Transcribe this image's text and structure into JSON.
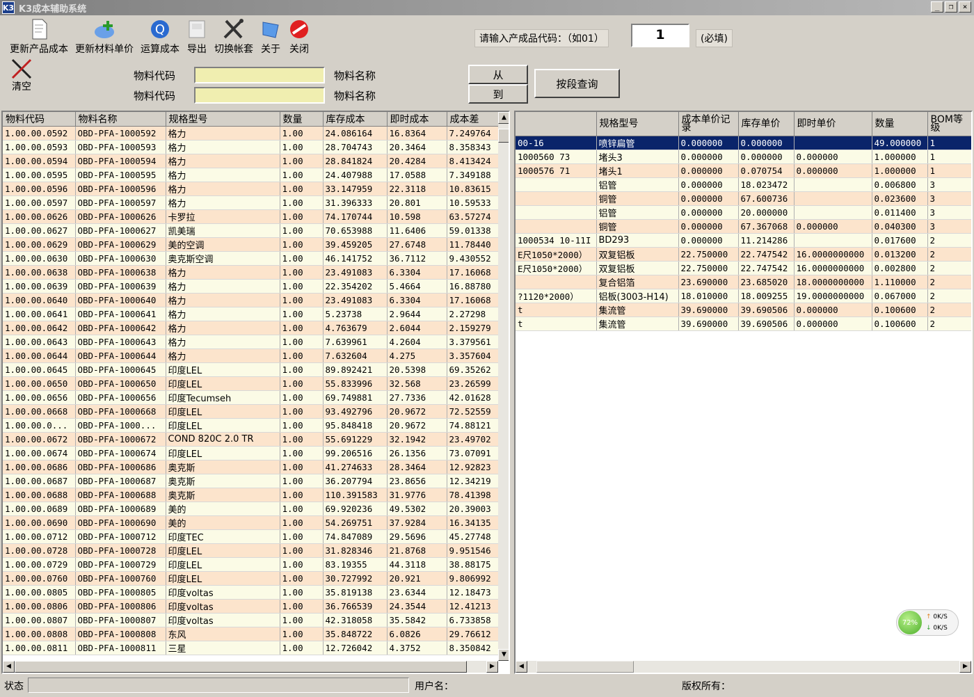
{
  "window": {
    "title": "K3成本辅助系统"
  },
  "toolbar": [
    {
      "key": "update_product_cost",
      "label": "更新产品成本",
      "icon": "document-icon"
    },
    {
      "key": "update_material_price",
      "label": "更新材料单价",
      "icon": "refresh-arrow-icon"
    },
    {
      "key": "calculate_cost",
      "label": "运算成本",
      "icon": "calculate-q-icon"
    },
    {
      "key": "export",
      "label": "导出",
      "icon": "export-icon"
    },
    {
      "key": "switch_account",
      "label": "切换帐套",
      "icon": "tools-icon"
    },
    {
      "key": "about",
      "label": "关于",
      "icon": "about-icon"
    },
    {
      "key": "close",
      "label": "关闭",
      "icon": "stop-icon"
    }
  ],
  "clear_label": "清空",
  "query": {
    "material_code_label": "物料代码",
    "material_name_label": "物料名称",
    "from_label": "从",
    "to_label": "到",
    "range_query_label": "按段查询",
    "product_code_prompt": "请输入产成品代码：（如01）",
    "product_code_value": "1",
    "required_label": "(必填)"
  },
  "left_grid": {
    "headers": [
      "物料代码",
      "物料名称",
      "规格型号",
      "数量",
      "库存成本",
      "即时成本",
      "成本差"
    ],
    "rows": [
      [
        "1.00.00.0592",
        "OBD-PFA-1000592",
        "格力",
        "1.00",
        "24.086164",
        "16.8364",
        "7.249764"
      ],
      [
        "1.00.00.0593",
        "OBD-PFA-1000593",
        "格力",
        "1.00",
        "28.704743",
        "20.3464",
        "8.358343"
      ],
      [
        "1.00.00.0594",
        "OBD-PFA-1000594",
        "格力",
        "1.00",
        "28.841824",
        "20.4284",
        "8.413424"
      ],
      [
        "1.00.00.0595",
        "OBD-PFA-1000595",
        "格力",
        "1.00",
        "24.407988",
        "17.0588",
        "7.349188"
      ],
      [
        "1.00.00.0596",
        "OBD-PFA-1000596",
        "格力",
        "1.00",
        "33.147959",
        "22.3118",
        "10.83615"
      ],
      [
        "1.00.00.0597",
        "OBD-PFA-1000597",
        "格力",
        "1.00",
        "31.396333",
        "20.801",
        "10.59533"
      ],
      [
        "1.00.00.0626",
        "OBD-PFA-1000626",
        "卡罗拉",
        "1.00",
        "74.170744",
        "10.598",
        "63.57274"
      ],
      [
        "1.00.00.0627",
        "OBD-PFA-1000627",
        "凯美瑞",
        "1.00",
        "70.653988",
        "11.6406",
        "59.01338"
      ],
      [
        "1.00.00.0629",
        "OBD-PFA-1000629",
        "美的空调",
        "1.00",
        "39.459205",
        "27.6748",
        "11.78440"
      ],
      [
        "1.00.00.0630",
        "OBD-PFA-1000630",
        "奥克斯空调",
        "1.00",
        "46.141752",
        "36.7112",
        "9.430552"
      ],
      [
        "1.00.00.0638",
        "OBD-PFA-1000638",
        "格力",
        "1.00",
        "23.491083",
        "6.3304",
        "17.16068"
      ],
      [
        "1.00.00.0639",
        "OBD-PFA-1000639",
        "格力",
        "1.00",
        "22.354202",
        "5.4664",
        "16.88780"
      ],
      [
        "1.00.00.0640",
        "OBD-PFA-1000640",
        "格力",
        "1.00",
        "23.491083",
        "6.3304",
        "17.16068"
      ],
      [
        "1.00.00.0641",
        "OBD-PFA-1000641",
        "格力",
        "1.00",
        "5.23738",
        "2.9644",
        "2.27298"
      ],
      [
        "1.00.00.0642",
        "OBD-PFA-1000642",
        "格力",
        "1.00",
        "4.763679",
        "2.6044",
        "2.159279"
      ],
      [
        "1.00.00.0643",
        "OBD-PFA-1000643",
        "格力",
        "1.00",
        "7.639961",
        "4.2604",
        "3.379561"
      ],
      [
        "1.00.00.0644",
        "OBD-PFA-1000644",
        "格力",
        "1.00",
        "7.632604",
        "4.275",
        "3.357604"
      ],
      [
        "1.00.00.0645",
        "OBD-PFA-1000645",
        "印度LEL",
        "1.00",
        "89.892421",
        "20.5398",
        "69.35262"
      ],
      [
        "1.00.00.0650",
        "OBD-PFA-1000650",
        "印度LEL",
        "1.00",
        "55.833996",
        "32.568",
        "23.26599"
      ],
      [
        "1.00.00.0656",
        "OBD-PFA-1000656",
        "印度Tecumseh",
        "1.00",
        "69.749881",
        "27.7336",
        "42.01628"
      ],
      [
        "1.00.00.0668",
        "OBD-PFA-1000668",
        "印度LEL",
        "1.00",
        "93.492796",
        "20.9672",
        "72.52559"
      ],
      [
        "1.00.00.0...",
        "OBD-PFA-1000...",
        "印度LEL",
        "1.00",
        "95.848418",
        "20.9672",
        "74.88121"
      ],
      [
        "1.00.00.0672",
        "OBD-PFA-1000672",
        "COND 820C 2.0 TR",
        "1.00",
        "55.691229",
        "32.1942",
        "23.49702"
      ],
      [
        "1.00.00.0674",
        "OBD-PFA-1000674",
        "印度LEL",
        "1.00",
        "99.206516",
        "26.1356",
        "73.07091"
      ],
      [
        "1.00.00.0686",
        "OBD-PFA-1000686",
        "奥克斯",
        "1.00",
        "41.274633",
        "28.3464",
        "12.92823"
      ],
      [
        "1.00.00.0687",
        "OBD-PFA-1000687",
        "奥克斯",
        "1.00",
        "36.207794",
        "23.8656",
        "12.34219"
      ],
      [
        "1.00.00.0688",
        "OBD-PFA-1000688",
        "奥克斯",
        "1.00",
        "110.391583",
        "31.9776",
        "78.41398"
      ],
      [
        "1.00.00.0689",
        "OBD-PFA-1000689",
        "美的",
        "1.00",
        "69.920236",
        "49.5302",
        "20.39003"
      ],
      [
        "1.00.00.0690",
        "OBD-PFA-1000690",
        "美的",
        "1.00",
        "54.269751",
        "37.9284",
        "16.34135"
      ],
      [
        "1.00.00.0712",
        "OBD-PFA-1000712",
        "印度TEC",
        "1.00",
        "74.847089",
        "29.5696",
        "45.27748"
      ],
      [
        "1.00.00.0728",
        "OBD-PFA-1000728",
        "印度LEL",
        "1.00",
        "31.828346",
        "21.8768",
        "9.951546"
      ],
      [
        "1.00.00.0729",
        "OBD-PFA-1000729",
        "印度LEL",
        "1.00",
        "83.19355",
        "44.3118",
        "38.88175"
      ],
      [
        "1.00.00.0760",
        "OBD-PFA-1000760",
        "印度LEL",
        "1.00",
        "30.727992",
        "20.921",
        "9.806992"
      ],
      [
        "1.00.00.0805",
        "OBD-PFA-1000805",
        "印度voltas",
        "1.00",
        "35.819138",
        "23.6344",
        "12.18473"
      ],
      [
        "1.00.00.0806",
        "OBD-PFA-1000806",
        "印度voltas",
        "1.00",
        "36.766539",
        "24.3544",
        "12.41213"
      ],
      [
        "1.00.00.0807",
        "OBD-PFA-1000807",
        "印度voltas",
        "1.00",
        "42.318058",
        "35.5842",
        "6.733858"
      ],
      [
        "1.00.00.0808",
        "OBD-PFA-1000808",
        "东风",
        "1.00",
        "35.848722",
        "6.0826",
        "29.76612"
      ],
      [
        "1.00.00.0811",
        "OBD-PFA-1000811",
        "三星",
        "1.00",
        "12.726042",
        "4.3752",
        "8.350842"
      ]
    ]
  },
  "right_grid": {
    "headers": [
      "",
      "规格型号",
      "成本单价记录",
      "库存单价",
      "即时单价",
      "数量",
      "BOM等级"
    ],
    "rows": [
      [
        "00-16",
        "喷锌扁管",
        "0.000000",
        "0.000000",
        "",
        "49.000000",
        "1"
      ],
      [
        "1000560 73",
        "堵头3",
        "0.000000",
        "0.000000",
        "0.000000",
        "1.000000",
        "1"
      ],
      [
        "1000576 71",
        "堵头1",
        "0.000000",
        "0.070754",
        "0.000000",
        "1.000000",
        "1"
      ],
      [
        "",
        "铝管",
        "0.000000",
        "18.023472",
        "",
        "0.006800",
        "3"
      ],
      [
        "",
        "铜管",
        "0.000000",
        "67.600736",
        "",
        "0.023600",
        "3"
      ],
      [
        "",
        "铝管",
        "0.000000",
        "20.000000",
        "",
        "0.011400",
        "3"
      ],
      [
        "",
        "铜管",
        "0.000000",
        "67.367068",
        "0.000000",
        "0.040300",
        "3"
      ],
      [
        "1000534 10-11I",
        "BD293",
        "0.000000",
        "11.214286",
        "",
        "0.017600",
        "2"
      ],
      [
        "E尺1050*2000）",
        "双复铝板",
        "22.750000",
        "22.747542",
        "16.0000000000",
        "0.013200",
        "2"
      ],
      [
        "E尺1050*2000）",
        "双复铝板",
        "22.750000",
        "22.747542",
        "16.0000000000",
        "0.002800",
        "2"
      ],
      [
        "",
        "复合铝箔",
        "23.690000",
        "23.685020",
        "18.0000000000",
        "1.110000",
        "2"
      ],
      [
        "?1120*2000）",
        "铝板(3003-H14)",
        "18.010000",
        "18.009255",
        "19.0000000000",
        "0.067000",
        "2"
      ],
      [
        "t",
        "集流管",
        "39.690000",
        "39.690506",
        "0.000000",
        "0.100600",
        "2"
      ],
      [
        "t",
        "集流管",
        "39.690000",
        "39.690506",
        "0.000000",
        "0.100600",
        "2"
      ]
    ]
  },
  "status": {
    "status_label": "状态",
    "user_label": "用户名：",
    "copyright_label": "版权所有："
  },
  "net_widget": {
    "percent": "72%",
    "up": "0K/S",
    "down": "0K/S"
  }
}
